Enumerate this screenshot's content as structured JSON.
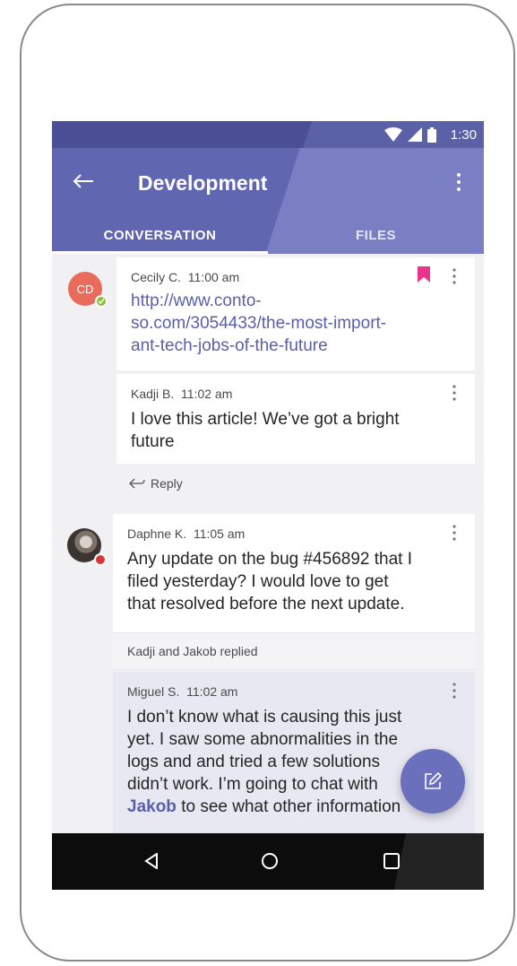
{
  "status_bar": {
    "time": "1:30",
    "icons": [
      "wifi-icon",
      "signal-icon",
      "battery-icon"
    ]
  },
  "app_bar": {
    "title": "Development",
    "back_icon": "arrow-left-icon",
    "more_icon": "more-vertical-icon",
    "tabs": [
      {
        "label": "CONVERSATION",
        "selected": true
      },
      {
        "label": "FILES",
        "selected": false
      }
    ]
  },
  "messages": [
    {
      "avatar_initials": "CD",
      "presence": "available",
      "author": "Cecily C.",
      "time": "11:00 am",
      "bookmarked": true,
      "text_lines": [
        "http://www.conto-",
        "so.com/3054433/the-most-import-",
        "ant-tech-jobs-of-the-future"
      ]
    },
    {
      "author": "Kadji B.",
      "time": "11:02 am",
      "text_lines": [
        "I love this article! We’ve got a bright",
        "future"
      ]
    },
    {
      "presence": "busy",
      "author": "Daphne K.",
      "time": "11:05 am",
      "text_lines": [
        "Any update on the bug #456892 that I",
        "filed yesterday? I would love to get",
        "that resolved before the next update."
      ]
    },
    {
      "author": "Miguel S.",
      "time": "11:02 am",
      "text_lines": [
        "I don’t know what is causing this just",
        "yet. I saw some abnormalities in the",
        "logs and and tried a few solutions",
        "didn’t work. I’m going to chat with"
      ],
      "mention": "Jakob",
      "text_tail": " to see what other information"
    }
  ],
  "reply_label": "Reply",
  "replies_summary": "Kadji and Jakob replied",
  "fab_icon": "compose-icon",
  "nav_icons": [
    "back-triangle-icon",
    "home-circle-icon",
    "recents-square-icon"
  ],
  "colors": {
    "brand": "#6166b1",
    "brand_dark": "#4a4f96",
    "bookmark": "#e8348a",
    "available": "#8cbc3a",
    "busy": "#d9343a"
  }
}
